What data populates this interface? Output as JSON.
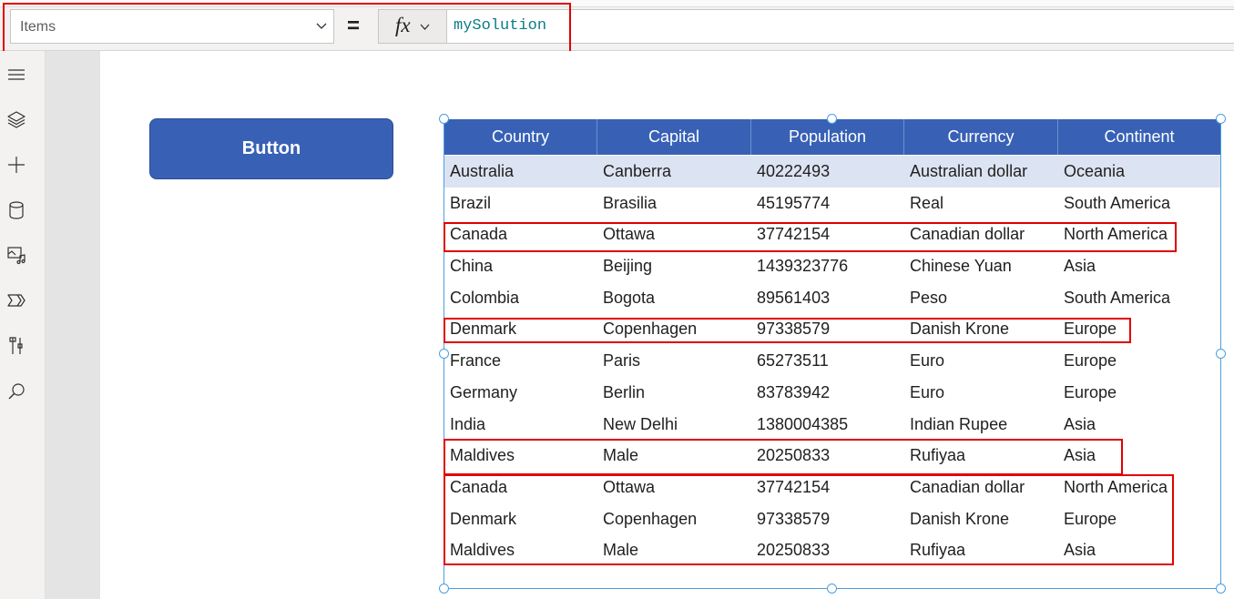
{
  "formula_bar": {
    "property": "Items",
    "equals": "=",
    "fx_label": "fx",
    "formula": "mySolution"
  },
  "left_rail": {
    "icons": [
      "hamburger-menu-icon",
      "layers-icon",
      "plus-icon",
      "database-icon",
      "media-icon",
      "power-automate-icon",
      "tools-icon",
      "search-icon"
    ]
  },
  "button": {
    "label": "Button"
  },
  "gallery": {
    "columns": [
      "Country",
      "Capital",
      "Population",
      "Currency",
      "Continent"
    ],
    "rows": [
      [
        "Australia",
        "Canberra",
        "40222493",
        "Australian dollar",
        "Oceania"
      ],
      [
        "Brazil",
        "Brasilia",
        "45195774",
        "Real",
        "South America"
      ],
      [
        "Canada",
        "Ottawa",
        "37742154",
        "Canadian dollar",
        "North America"
      ],
      [
        "China",
        "Beijing",
        "1439323776",
        "Chinese Yuan",
        "Asia"
      ],
      [
        "Colombia",
        "Bogota",
        "89561403",
        "Peso",
        "South America"
      ],
      [
        "Denmark",
        "Copenhagen",
        "97338579",
        "Danish Krone",
        "Europe"
      ],
      [
        "France",
        "Paris",
        "65273511",
        "Euro",
        "Europe"
      ],
      [
        "Germany",
        "Berlin",
        "83783942",
        "Euro",
        "Europe"
      ],
      [
        "India",
        "New Delhi",
        "1380004385",
        "Indian Rupee",
        "Asia"
      ],
      [
        "Maldives",
        "Male",
        "20250833",
        "Rufiyaa",
        "Asia"
      ],
      [
        "Canada",
        "Ottawa",
        "37742154",
        "Canadian dollar",
        "North America"
      ],
      [
        "Denmark",
        "Copenhagen",
        "97338579",
        "Danish Krone",
        "Europe"
      ],
      [
        "Maldives",
        "Male",
        "20250833",
        "Rufiyaa",
        "Asia"
      ]
    ],
    "selected_row": 0
  },
  "colors": {
    "header_blue": "#3861b6",
    "selection": "#dce3f2",
    "highlight_red": "#e00000",
    "formula_teal": "#0a7d87"
  }
}
